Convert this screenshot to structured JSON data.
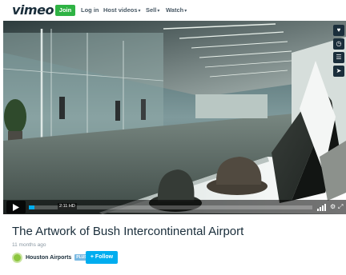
{
  "header": {
    "logo": "vimeo",
    "join_label": "Join",
    "nav": [
      "Log in",
      "Host videos",
      "Sell",
      "Watch"
    ]
  },
  "player": {
    "time_label": "2:11 HD",
    "progress_fraction": 0.02,
    "side_actions": [
      "heart-icon",
      "clock-icon",
      "layers-icon",
      "send-icon"
    ],
    "controls": [
      "play-icon",
      "volume-icon",
      "settings-icon",
      "fullscreen-icon"
    ]
  },
  "video": {
    "title": "The Artwork of Bush Intercontinental Airport",
    "posted": "11 months ago"
  },
  "channel": {
    "name": "Houston Airports",
    "badge": "PLUS",
    "follow_label": "+ Follow"
  },
  "colors": {
    "join_green": "#2fb344",
    "follow_blue": "#00adef",
    "text_dark": "#1a2e3b"
  }
}
